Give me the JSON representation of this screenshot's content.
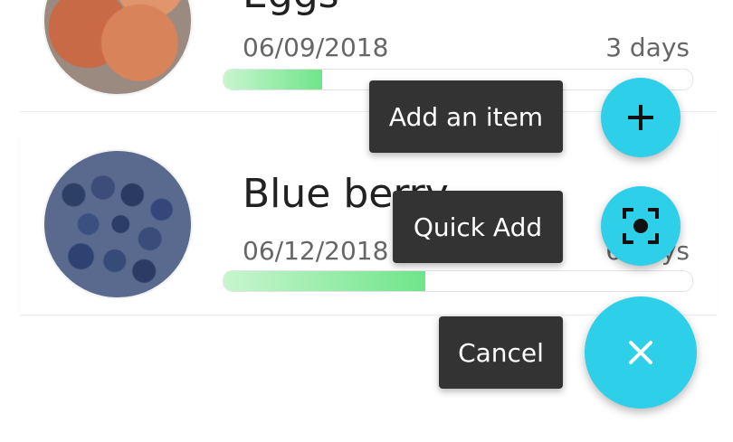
{
  "items": [
    {
      "name": "Eggs",
      "date": "06/09/2018",
      "remaining": "3 days",
      "progress": 0.21,
      "image_icon": "eggs-photo"
    },
    {
      "name": "Blue berry",
      "date": "06/12/2018",
      "remaining": "6 days",
      "progress": 0.43,
      "image_icon": "blueberry-photo"
    }
  ],
  "fab_menu": {
    "add_label": "Add an item",
    "quick_add_label": "Quick Add",
    "cancel_label": "Cancel",
    "add_icon": "plus-icon",
    "quick_add_icon": "scan-icon",
    "cancel_icon": "close-icon"
  },
  "colors": {
    "fab": "#2ecfe8",
    "label_bg": "#333333",
    "progress_fill": "#6fe58a"
  }
}
